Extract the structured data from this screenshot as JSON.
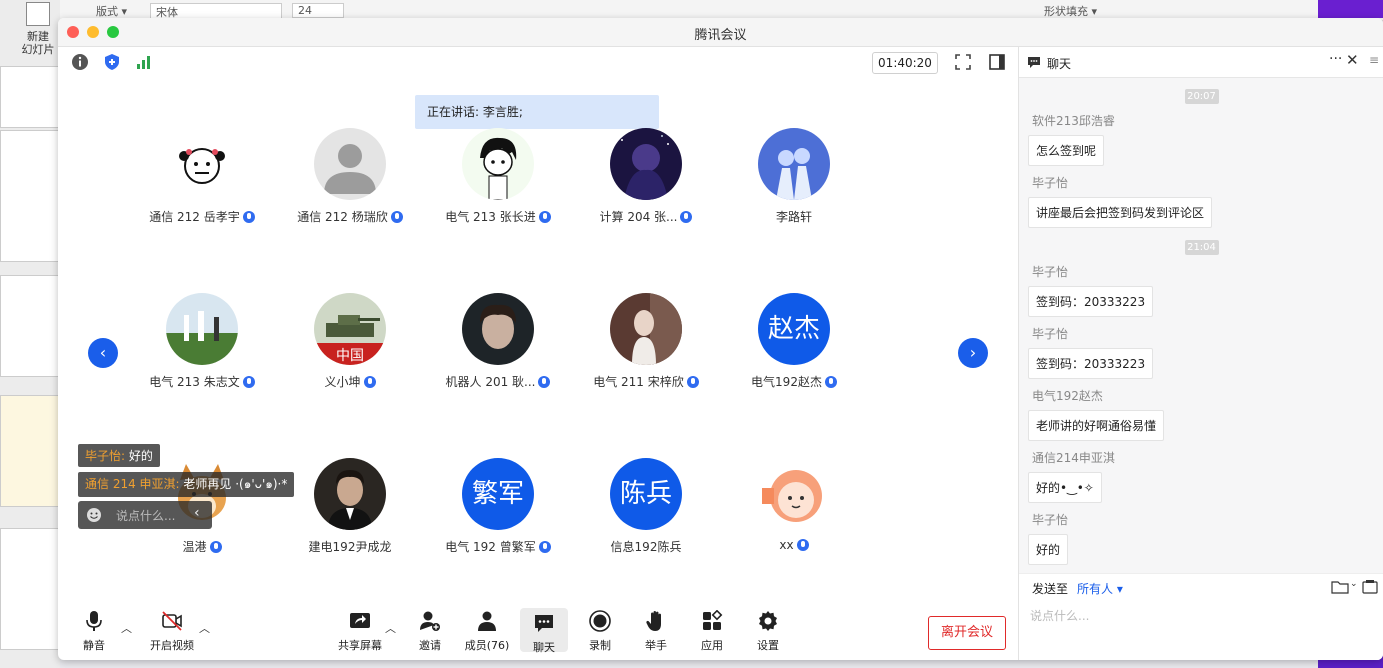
{
  "ppt": {
    "new_label_1": "新建",
    "new_label_2": "幻灯片",
    "layout_label": "版式",
    "font_name": "宋体",
    "font_size": "24",
    "shape_fill": "形状填充"
  },
  "window": {
    "title": "腾讯会议",
    "timer": "01:40:20",
    "speaking_label": "正在讲话: 李言胜;"
  },
  "participants": [
    {
      "name": "通信 212 岳孝宇",
      "avatar": "cartoon-face",
      "mic": true
    },
    {
      "name": "通信 212 杨瑞欣",
      "avatar": "default-person",
      "mic": true
    },
    {
      "name": "电气 213 张长进",
      "avatar": "anime-boy",
      "mic": true
    },
    {
      "name": "计算 204 张...",
      "avatar": "night-sky",
      "mic": true
    },
    {
      "name": "李路轩",
      "avatar": "anime-couple",
      "mic": false
    },
    {
      "name": "电气 213 朱志文",
      "avatar": "photo-field",
      "mic": true
    },
    {
      "name": "义小坤",
      "avatar": "tank",
      "mic": true
    },
    {
      "name": "机器人 201 耿...",
      "avatar": "photo-face",
      "mic": true
    },
    {
      "name": "电气 211 宋梓欣",
      "avatar": "photo-girl",
      "mic": true
    },
    {
      "name": "电气192赵杰",
      "avatar_text": "赵杰",
      "mic": true
    },
    {
      "name": "温港",
      "avatar": "shiba",
      "mic": true
    },
    {
      "name": "建电192尹成龙",
      "avatar": "photo-man",
      "mic": false
    },
    {
      "name": "电气 192 曾繁军",
      "avatar_text": "繁军",
      "mic": true
    },
    {
      "name": "信息192陈兵",
      "avatar_text": "陈兵",
      "mic": false
    },
    {
      "name": "xx",
      "avatar": "cartoon-orange",
      "mic": true
    }
  ],
  "popups": {
    "pop1_name": "毕子怡:",
    "pop1_text": " 好的",
    "pop2_name": "通信 214 申亚淇:",
    "pop2_text": " 老师再见 ·(๑'ᴗ'๑)·*",
    "say_placeholder": "说点什么..."
  },
  "bottombar": {
    "mute": "静音",
    "video": "开启视频",
    "share": "共享屏幕",
    "invite": "邀请",
    "members": "成员(76)",
    "chat": "聊天",
    "record": "录制",
    "raise": "举手",
    "apps": "应用",
    "settings": "设置",
    "leave": "离开会议"
  },
  "chat": {
    "title": "聊天",
    "messages": [
      {
        "time": "20:07"
      },
      {
        "sender": "软件213邱浩睿",
        "text": "怎么签到呢"
      },
      {
        "sender": "毕子怡",
        "text": "讲座最后会把签到码发到评论区"
      },
      {
        "time": "21:04"
      },
      {
        "sender": "毕子怡",
        "text": "签到码：20333223"
      },
      {
        "sender": "毕子怡",
        "text": "签到码：20333223"
      },
      {
        "sender": "电气192赵杰",
        "text": "老师讲的好啊通俗易懂"
      },
      {
        "sender": "通信214申亚淇",
        "text": "好的•‿•✧"
      },
      {
        "sender": "毕子怡",
        "text": "好的"
      }
    ],
    "send_to_label": "发送至",
    "send_to_value": "所有人",
    "input_placeholder": "说点什么..."
  },
  "colors": {
    "accent": "#1a5eea",
    "leave_red": "#e02a2a",
    "speaking_bg": "#d8e6fb"
  }
}
